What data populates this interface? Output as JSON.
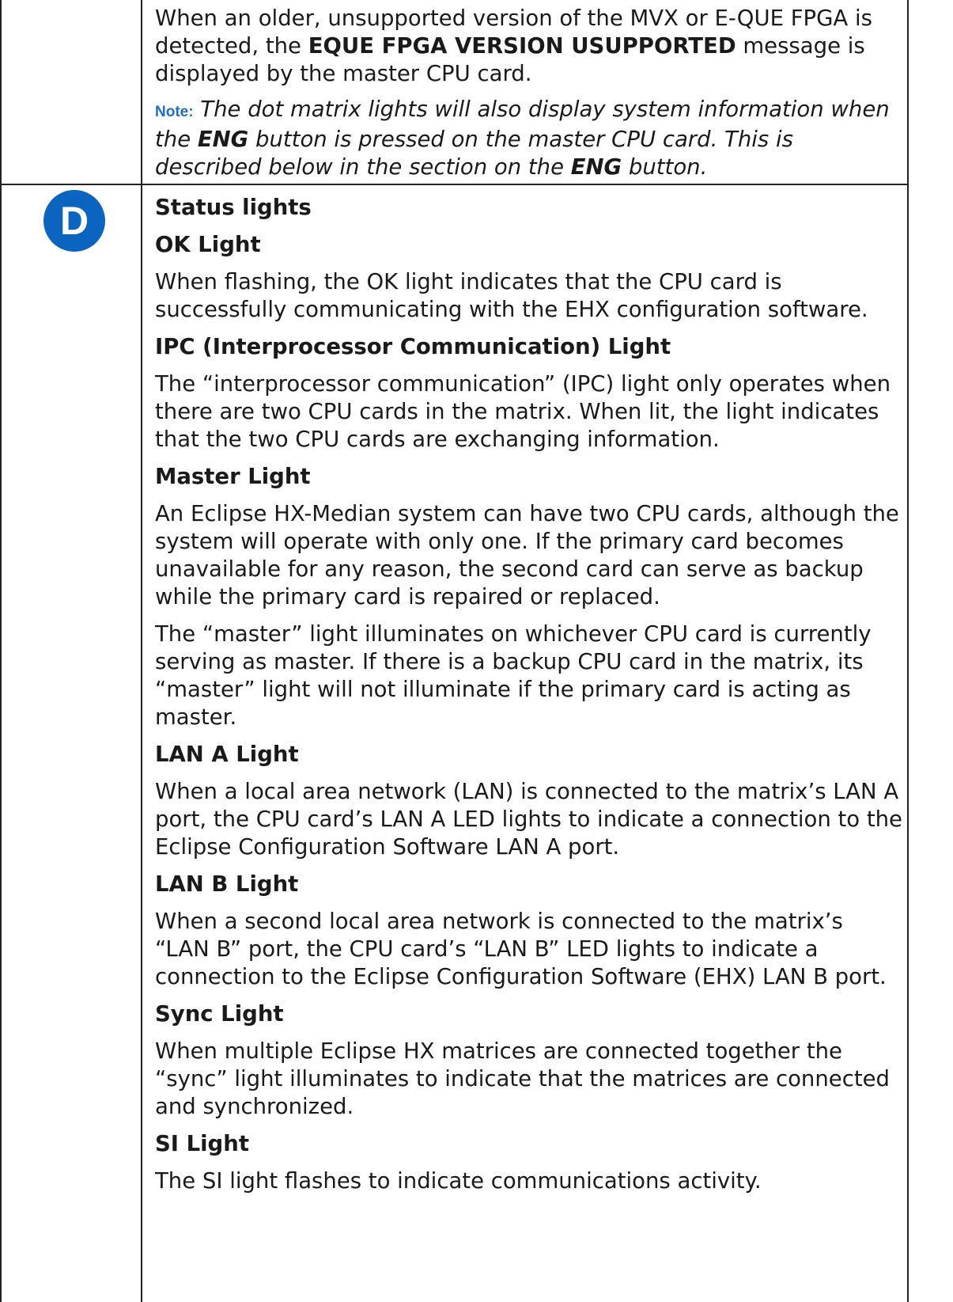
{
  "top_cell": {
    "para1_a": "When an older, unsupported version of the MVX or E-QUE FPGA is detected, the ",
    "para1_bold": "EQUE FPGA VERSION USUPPORTED",
    "para1_b": " message is displayed by the master CPU card.",
    "note_label": "Note:",
    "note_a": " The dot matrix lights will also display system information when the ",
    "note_bold1": "ENG",
    "note_b": " button is pressed on the master CPU card. This is described below in the section on the ",
    "note_bold2": "ENG",
    "note_c": " button."
  },
  "badge": {
    "letter": "D",
    "color": "#0b64bf"
  },
  "bottom_cell": {
    "section_title": "Status lights",
    "ok_heading": "OK Light",
    "ok_text": "When flashing, the OK light indicates that the CPU card is successfully communicating with the EHX configuration software.",
    "ipc_heading": "IPC (Interprocessor Communication) Light",
    "ipc_text": "The “interprocessor communication” (IPC) light only operates when there are two CPU cards in the matrix. When lit, the light indicates that the two CPU cards are exchanging information.",
    "master_heading": "Master Light",
    "master_text1": "An Eclipse HX-Median system can have two CPU cards, although the system will operate with only one. If the primary card becomes unavailable for any reason, the second card can serve as backup while the primary card is repaired or replaced.",
    "master_text2": "The “master” light illuminates on whichever CPU card is currently serving as master. If there is a backup CPU card in the matrix, its “master” light will not illuminate if the primary card is acting as master.",
    "lana_heading": "LAN A Light",
    "lana_text": "When a local area network (LAN) is connected to the matrix’s LAN A port, the CPU card’s LAN A LED lights to indicate a connection to the Eclipse Configuration Software LAN A port.",
    "lanb_heading": "LAN B Light",
    "lanb_text": "When a second local area network is connected to the matrix’s “LAN B” port, the CPU card’s “LAN B” LED lights to indicate a connection to the Eclipse Configuration Software (EHX) LAN B port.",
    "sync_heading": "Sync Light",
    "sync_text": "When multiple Eclipse HX matrices are connected together the “sync” light illuminates to indicate that the matrices are connected and synchronized.",
    "si_heading": "SI Light",
    "si_text": "The SI light flashes to indicate communications activity."
  }
}
